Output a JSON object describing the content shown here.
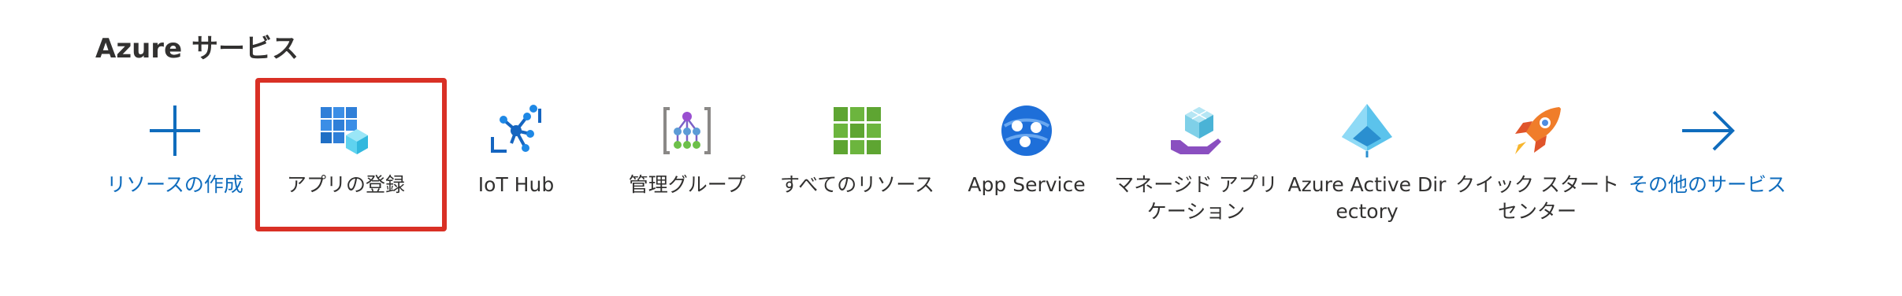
{
  "section": {
    "title": "Azure サービス"
  },
  "services": [
    {
      "label": "リソースの作成",
      "icon": "plus-icon",
      "is_link": true
    },
    {
      "label": "アプリの登録",
      "icon": "app-registrations-icon",
      "is_link": false,
      "highlighted": true
    },
    {
      "label": "IoT Hub",
      "icon": "iot-hub-icon",
      "is_link": false
    },
    {
      "label": "管理グループ",
      "icon": "management-groups-icon",
      "is_link": false
    },
    {
      "label": "すべてのリソース",
      "icon": "all-resources-icon",
      "is_link": false
    },
    {
      "label": "App Service",
      "icon": "app-service-icon",
      "is_link": false
    },
    {
      "label": "マネージド アプリケーション",
      "icon": "managed-applications-icon",
      "is_link": false
    },
    {
      "label": "Azure Active Directory",
      "icon": "azure-active-directory-icon",
      "is_link": false
    },
    {
      "label": "クイック スタート センター",
      "icon": "quickstart-center-icon",
      "is_link": false
    },
    {
      "label": "その他のサービス",
      "icon": "arrow-right-icon",
      "is_link": true
    }
  ],
  "colors": {
    "link": "#0f6cbd",
    "text": "#323130",
    "highlight": "#d93025"
  }
}
